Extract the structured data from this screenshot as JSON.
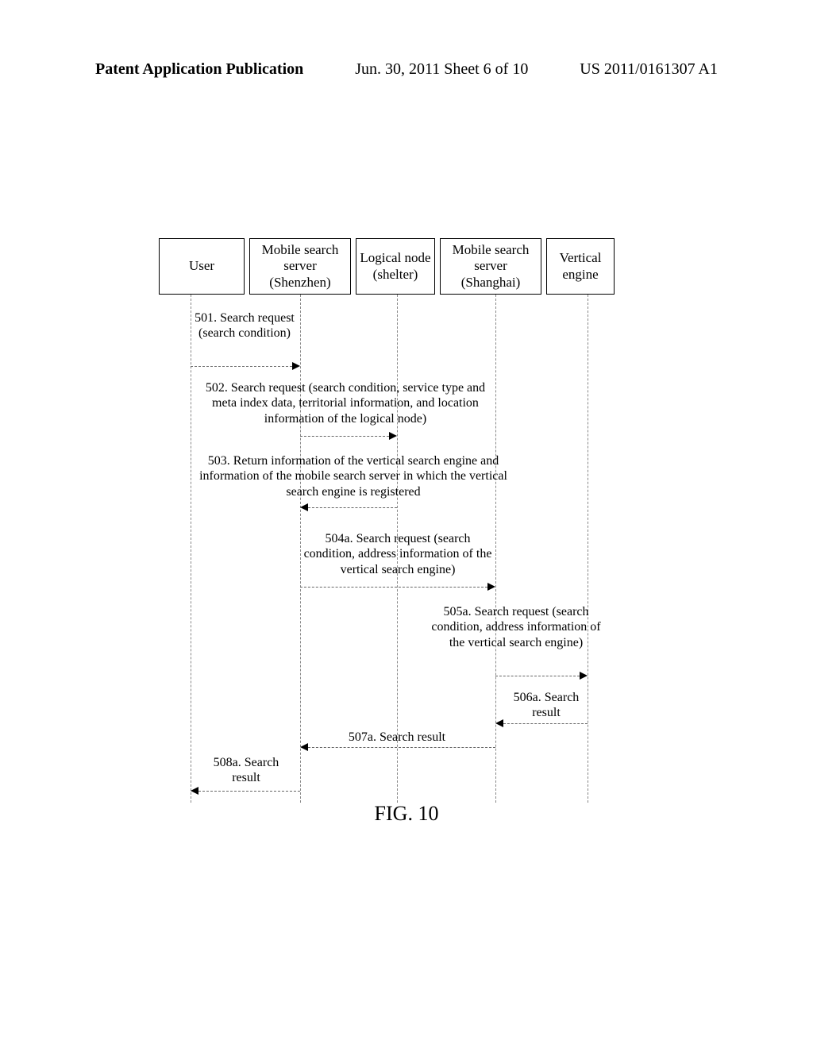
{
  "header": {
    "left": "Patent Application Publication",
    "mid": "Jun. 30, 2011  Sheet 6 of 10",
    "right": "US 2011/0161307 A1"
  },
  "actors": {
    "a0": "User",
    "a1": "Mobile search server (Shenzhen)",
    "a2": "Logical node (shelter)",
    "a3": "Mobile search server (Shanghai)",
    "a4": "Vertical engine"
  },
  "messages": {
    "m501": "501. Search request (search condition)",
    "m502": "502. Search request (search condition, service type and meta index data, territorial information, and location information of the logical node)",
    "m503": "503. Return information of the vertical search engine and information of the mobile search server in which the vertical search engine is registered",
    "m504a": "504a. Search request (search condition, address information of the vertical search engine)",
    "m505a": "505a. Search request (search condition, address information of the vertical search engine)",
    "m506a": "506a. Search result",
    "m507a": "507a. Search result",
    "m508a": "508a. Search result"
  },
  "figure": "FIG. 10"
}
